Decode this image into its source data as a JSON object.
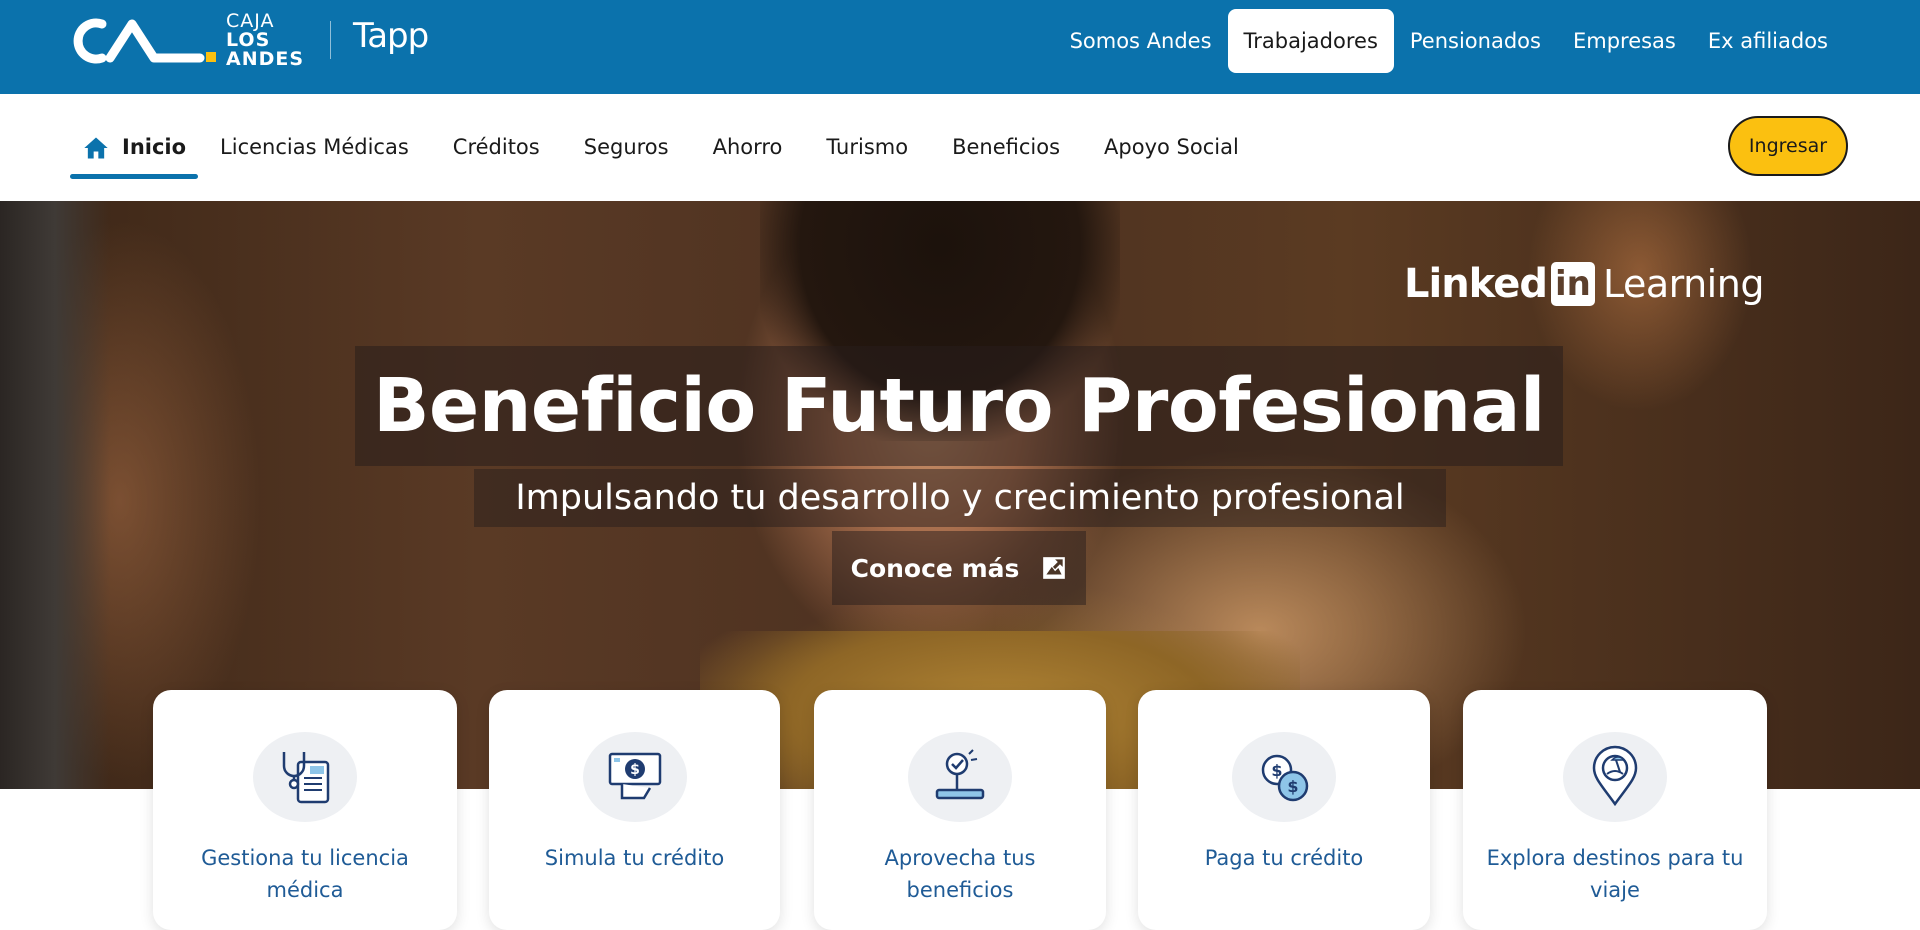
{
  "brand": {
    "line1": "CAJA",
    "line2": "LOS",
    "line3": "ANDES",
    "tapp": "Tapp"
  },
  "top_nav": [
    {
      "label": "Somos Andes",
      "active": false
    },
    {
      "label": "Trabajadores",
      "active": true
    },
    {
      "label": "Pensionados",
      "active": false
    },
    {
      "label": "Empresas",
      "active": false
    },
    {
      "label": "Ex afiliados",
      "active": false
    }
  ],
  "sub_nav": {
    "home_label": "Inicio",
    "items": [
      "Licencias Médicas",
      "Créditos",
      "Seguros",
      "Ahorro",
      "Turismo",
      "Beneficios",
      "Apoyo Social"
    ],
    "login_label": "Ingresar"
  },
  "hero": {
    "partner_word1": "Linked",
    "partner_in": "in",
    "partner_word2": "Learning",
    "title": "Beneficio Futuro Profesional",
    "subtitle": "Impulsando tu desarrollo y crecimiento profesional",
    "cta": "Conoce más"
  },
  "cards": [
    {
      "label": "Gestiona tu licencia médica",
      "icon": "medical-license-icon"
    },
    {
      "label": "Simula tu crédito",
      "icon": "credit-simulation-icon"
    },
    {
      "label": "Aprovecha tus beneficios",
      "icon": "benefits-icon"
    },
    {
      "label": "Paga tu crédito",
      "icon": "coins-icon"
    },
    {
      "label": "Explora destinos para tu viaje",
      "icon": "travel-destination-icon"
    }
  ],
  "colors": {
    "primary_blue": "#0b72ac",
    "accent_yellow": "#fbc010",
    "card_text": "#1f5b96"
  }
}
